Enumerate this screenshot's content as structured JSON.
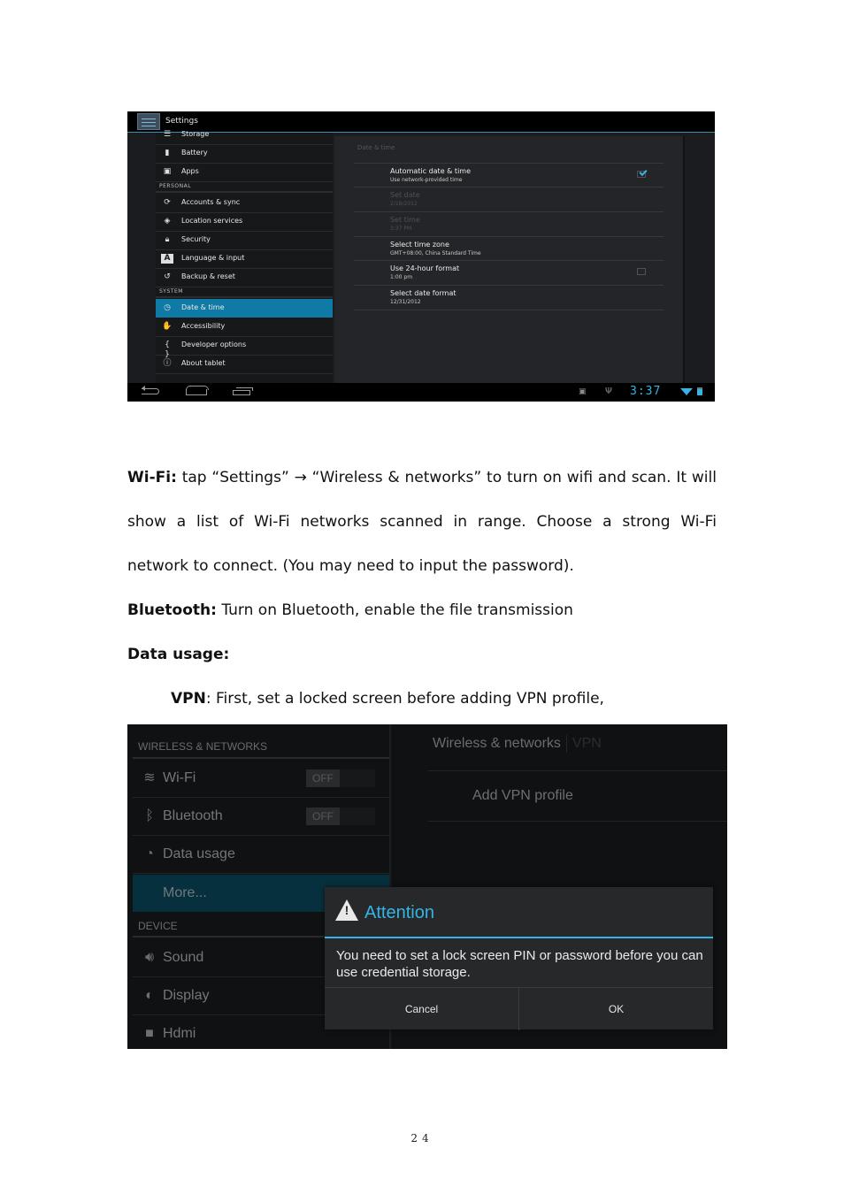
{
  "screenshot1": {
    "app_title": "Settings",
    "sidebar": {
      "items_top": [
        {
          "icon": "storage-icon",
          "glyph": "☰",
          "label": "Storage"
        },
        {
          "icon": "battery-icon",
          "glyph": "▮",
          "label": "Battery"
        },
        {
          "icon": "apps-icon",
          "glyph": "▣",
          "label": "Apps"
        }
      ],
      "section_personal": "PERSONAL",
      "items_personal": [
        {
          "icon": "sync-icon",
          "glyph": "⟳",
          "label": "Accounts & sync"
        },
        {
          "icon": "location-icon",
          "glyph": "◈",
          "label": "Location services"
        },
        {
          "icon": "lock-icon",
          "glyph": "🔒︎",
          "label": "Security"
        },
        {
          "icon": "language-icon",
          "glyph": "A",
          "label": "Language & input"
        },
        {
          "icon": "backup-icon",
          "glyph": "↺",
          "label": "Backup & reset"
        }
      ],
      "section_system": "SYSTEM",
      "items_system": [
        {
          "icon": "clock-icon",
          "glyph": "◷",
          "label": "Date & time",
          "selected": true
        },
        {
          "icon": "accessibility-hand-icon",
          "glyph": "✋",
          "label": "Accessibility"
        },
        {
          "icon": "developer-braces-icon",
          "glyph": "{ }",
          "label": "Developer options"
        },
        {
          "icon": "info-icon",
          "glyph": "ⓘ",
          "label": "About tablet"
        }
      ]
    },
    "detail": {
      "title": "Date & time",
      "rows": [
        {
          "title": "Automatic date & time",
          "summary": "Use network-provided time",
          "checkbox": true,
          "checked": true,
          "enabled": true
        },
        {
          "title": "Set date",
          "summary": "2/18/2012",
          "checkbox": false,
          "enabled": false
        },
        {
          "title": "Set time",
          "summary": "3:37 PM",
          "checkbox": false,
          "enabled": false
        },
        {
          "title": "Select time zone",
          "summary": "GMT+08:00, China Standard Time",
          "checkbox": false,
          "enabled": true
        },
        {
          "title": "Use 24-hour format",
          "summary": "1:00 pm",
          "checkbox": true,
          "checked": false,
          "enabled": true
        },
        {
          "title": "Select date format",
          "summary": "12/31/2012",
          "checkbox": false,
          "enabled": true
        }
      ]
    },
    "status_bar": {
      "clock": "3:37",
      "accent": "#33b5e5"
    }
  },
  "document": {
    "wifi": {
      "label": "Wi-Fi:",
      "line1_words": [
        "tap",
        "“Settings”",
        "→",
        "“Wireless",
        "&",
        "networks”",
        "to",
        "turn",
        "on",
        "wifi",
        "and",
        "scan.",
        "It",
        "will"
      ],
      "line2_words": [
        "show",
        "a",
        "list",
        "of",
        "Wi-Fi",
        "networks",
        "scanned",
        "in",
        "range.",
        "Choose",
        "a",
        "strong",
        "Wi-Fi"
      ],
      "line3": "network to connect. (You may need to input the password)."
    },
    "bluetooth": {
      "label": "Bluetooth:",
      "text": " Turn on Bluetooth, enable the file transmission"
    },
    "data_usage": {
      "label": "Data usage:"
    },
    "vpn": {
      "label": "VPN",
      "text": ": First, set a locked screen before adding VPN profile,"
    },
    "page_number": "24"
  },
  "screenshot2": {
    "section_wireless": "WIRELESS & NETWORKS",
    "items": [
      {
        "icon": "wifi-icon",
        "glyph": "≋",
        "label": "Wi-Fi",
        "toggle": "OFF"
      },
      {
        "icon": "bluetooth-icon",
        "glyph": "ᛒ",
        "label": "Bluetooth",
        "toggle": "OFF"
      },
      {
        "icon": "data-usage-icon",
        "glyph": "◔",
        "label": "Data usage"
      },
      {
        "icon": "more-icon",
        "glyph": "",
        "label": "More...",
        "selected": true
      }
    ],
    "section_device": "DEVICE",
    "device_items": [
      {
        "icon": "sound-icon",
        "glyph": "🔊︎",
        "label": "Sound"
      },
      {
        "icon": "display-icon",
        "glyph": "◐",
        "label": "Display"
      },
      {
        "icon": "hdmi-icon",
        "glyph": "■",
        "label": "Hdmi"
      }
    ],
    "breadcrumb": {
      "parent": "Wireless & networks",
      "current": "VPN"
    },
    "add_vpn_label": "Add VPN profile",
    "dialog": {
      "title": "Attention",
      "message": "You need to set a lock screen PIN or password before you can use credential storage.",
      "cancel_label": "Cancel",
      "ok_label": "OK",
      "accent": "#33b5e5"
    }
  }
}
